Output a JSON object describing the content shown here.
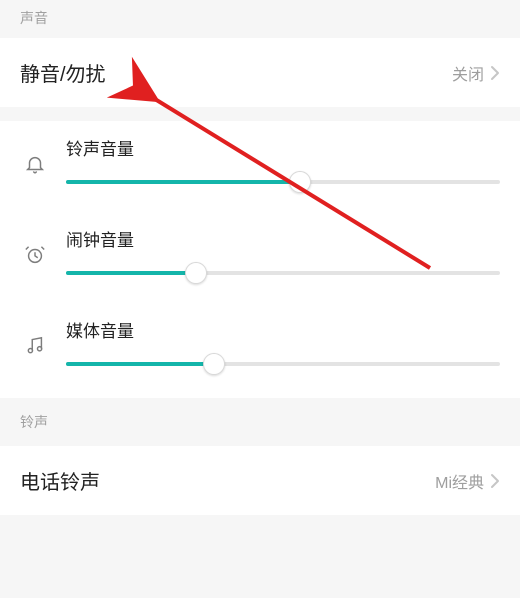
{
  "sections": {
    "sound_header": "声音",
    "ringtone_header": "铃声"
  },
  "rows": {
    "silent": {
      "title": "静音/勿扰",
      "value": "关闭"
    },
    "phone_ringtone": {
      "title": "电话铃声",
      "value": "Mi经典"
    }
  },
  "sliders": {
    "ringer": {
      "label": "铃声音量",
      "percent": 54
    },
    "alarm": {
      "label": "闹钟音量",
      "percent": 30
    },
    "media": {
      "label": "媒体音量",
      "percent": 34
    }
  }
}
